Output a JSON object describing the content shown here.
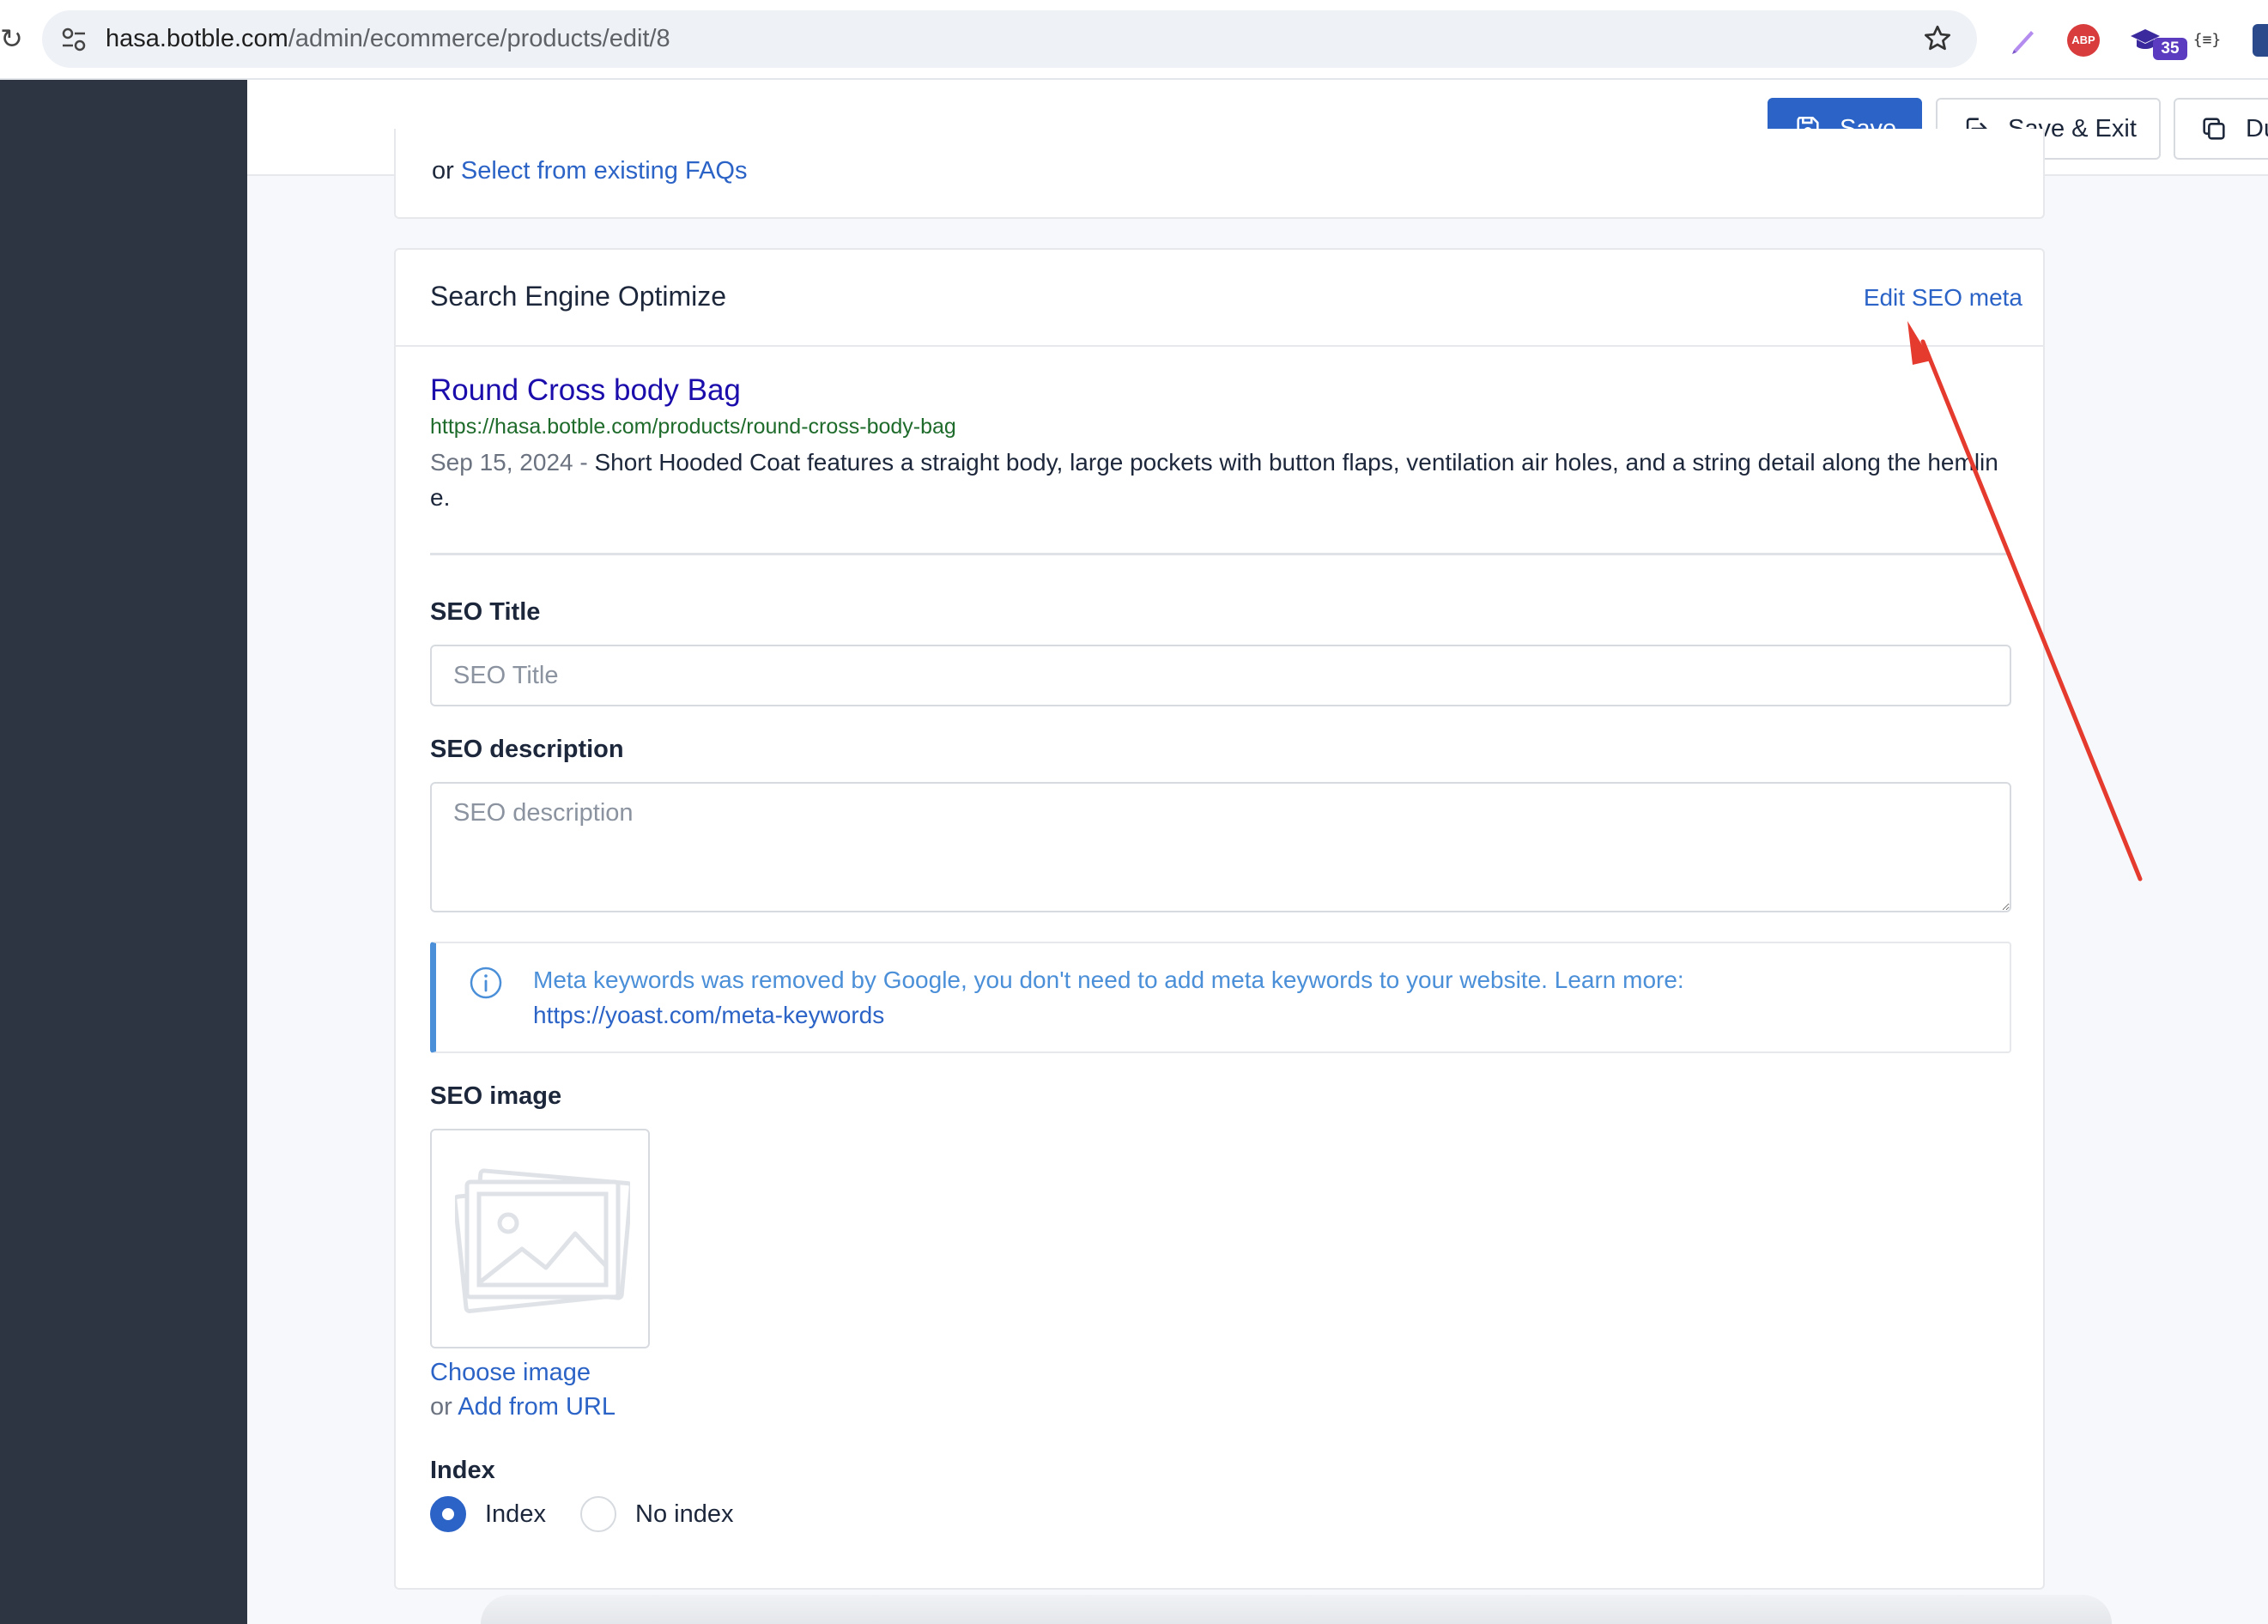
{
  "browser": {
    "url_host": "hasa.botble.com",
    "url_path": "/admin/ecommerce/products/edit/8",
    "extension_badge": "35",
    "extension_abp": "ABP",
    "extension_json": "{≡}"
  },
  "toolbar": {
    "save_label": "Save",
    "save_exit_label": "Save & Exit",
    "duplicate_label_visible": "Du"
  },
  "faq_card": {
    "prefix": "or",
    "link_text": "Select from existing FAQs"
  },
  "seo": {
    "title": "Search Engine Optimize",
    "edit_link": "Edit SEO meta",
    "preview": {
      "title": "Round Cross body Bag",
      "url": "https://hasa.botble.com/products/round-cross-body-bag",
      "date": "Sep 15, 2024 -",
      "description": "Short Hooded Coat features a straight body, large pockets with button flaps, ventilation air holes, and a string detail along the hemline."
    },
    "seo_title_label": "SEO Title",
    "seo_title_placeholder": "SEO Title",
    "seo_title_value": "",
    "seo_description_label": "SEO description",
    "seo_description_placeholder": "SEO description",
    "seo_description_value": "",
    "alert_text": "Meta keywords was removed by Google, you don't need to add meta keywords to your website. Learn more:",
    "alert_url": "https://yoast.com/meta-keywords",
    "seo_image_label": "SEO image",
    "choose_image": "Choose image",
    "or_text": "or",
    "add_from_url": "Add from URL",
    "index_label": "Index",
    "index_options": [
      {
        "label": "Index",
        "selected": true
      },
      {
        "label": "No index",
        "selected": false
      }
    ]
  },
  "colors": {
    "primary": "#2b63c6",
    "sidebar": "#2d3442",
    "annotation_arrow": "#e53a2e",
    "info": "#4a8fd8"
  }
}
